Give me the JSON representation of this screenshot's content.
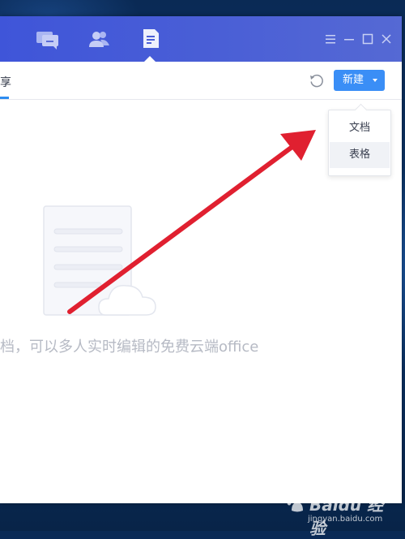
{
  "nav": {
    "items": [
      {
        "icon": "chat-bubble-icon"
      },
      {
        "icon": "contacts-icon"
      },
      {
        "icon": "document-icon",
        "active": true
      }
    ]
  },
  "window_controls": {
    "icons": [
      "menu-icon",
      "minimize-icon",
      "maximize-icon",
      "close-icon"
    ]
  },
  "toolbar": {
    "tab_share_label": "享",
    "new_button_label": "新建"
  },
  "dropdown": {
    "items": [
      {
        "label": "文档"
      },
      {
        "label": "表格",
        "highlighted": true
      }
    ]
  },
  "empty_state": {
    "text": "档，可以多人实时编辑的免费云端office"
  },
  "watermark": {
    "brand": "Baidu 经验",
    "site": "jingyan.baidu.com"
  },
  "colors": {
    "title_bar": "#4a5fd6",
    "accent": "#3a8ef6",
    "arrow": "#e02030",
    "empty_text": "#b6bac4"
  }
}
